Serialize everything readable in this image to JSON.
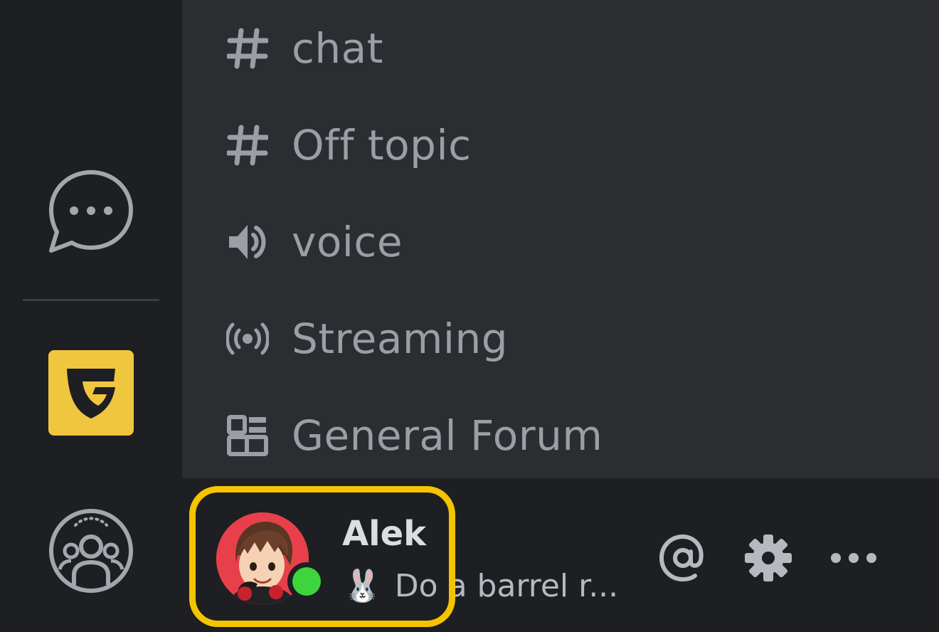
{
  "rail": {
    "dm_icon": "chat-bubble-icon",
    "guild_icon": "guilded-logo-icon",
    "friends_icon": "friends-group-icon"
  },
  "channels": [
    {
      "icon": "hash-icon",
      "label": "chat"
    },
    {
      "icon": "hash-icon",
      "label": "Off topic"
    },
    {
      "icon": "speaker-icon",
      "label": "voice"
    },
    {
      "icon": "broadcast-icon",
      "label": "Streaming"
    },
    {
      "icon": "forum-icon",
      "label": "General Forum"
    }
  ],
  "user": {
    "name": "Alek",
    "status_emoji": "🐰",
    "status_text": "Do a barrel r...",
    "presence": "online",
    "presence_color": "#3ed43e"
  },
  "userbar_actions": {
    "mention_icon": "at-icon",
    "settings_icon": "gear-icon",
    "more_icon": "ellipsis-icon"
  },
  "colors": {
    "accent_yellow": "#f5c400",
    "guild_yellow": "#f0c63f",
    "channel_text": "#9b9ea6"
  }
}
